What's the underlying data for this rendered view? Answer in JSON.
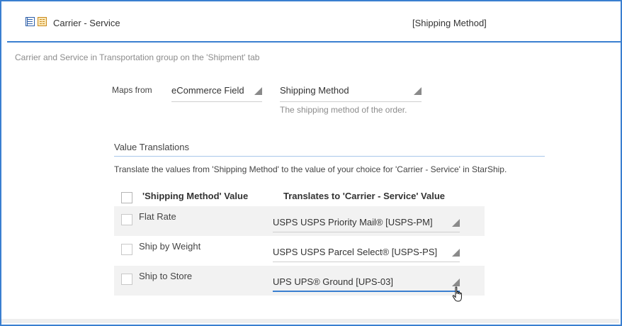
{
  "header": {
    "title": "Carrier - Service",
    "tag": "[Shipping Method]",
    "icons": [
      "list-icon",
      "field-icon"
    ]
  },
  "panel": {
    "description": "Carrier and Service in Transportation group on the 'Shipment' tab",
    "maps_from": {
      "label": "Maps from",
      "source_type": "eCommerce Field",
      "source_field": "Shipping Method",
      "help": "The shipping method of the order."
    },
    "value_translations": {
      "title": "Value Translations",
      "description": "Translate the values from 'Shipping Method' to the value of your choice for 'Carrier - Service' in StarShip.",
      "columns": [
        "'Shipping Method' Value",
        "Translates to 'Carrier - Service' Value"
      ],
      "rows": [
        {
          "name": "Flat Rate",
          "value": "USPS USPS Priority Mail® [USPS-PM]"
        },
        {
          "name": "Ship by Weight",
          "value": "USPS USPS Parcel Select® [USPS-PS]"
        },
        {
          "name": "Ship to Store",
          "value": "UPS UPS® Ground [UPS-03]"
        }
      ]
    }
  },
  "colors": {
    "accent": "#3a7fd0",
    "row_shade": "#f2f2f2",
    "muted_text": "#8c8c8c"
  }
}
